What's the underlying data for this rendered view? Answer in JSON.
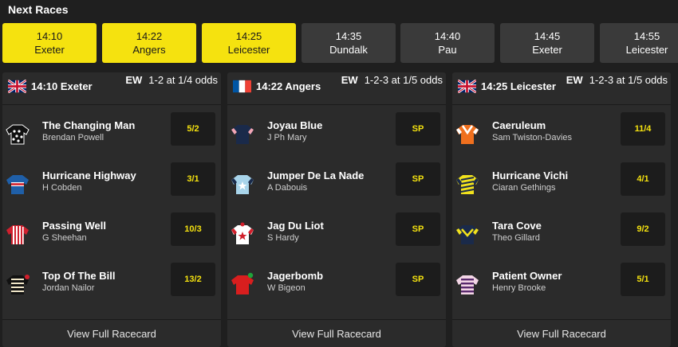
{
  "section_title": "Next Races",
  "tabs": [
    {
      "time": "14:10",
      "course": "Exeter",
      "active": true
    },
    {
      "time": "14:22",
      "course": "Angers",
      "active": true
    },
    {
      "time": "14:25",
      "course": "Leicester",
      "active": true
    },
    {
      "time": "14:35",
      "course": "Dundalk",
      "active": false
    },
    {
      "time": "14:40",
      "course": "Pau",
      "active": false
    },
    {
      "time": "14:45",
      "course": "Exeter",
      "active": false
    },
    {
      "time": "14:55",
      "course": "Leicester",
      "active": false
    }
  ],
  "cards": [
    {
      "flag": "uk-flag-icon",
      "race": "14:10 Exeter",
      "ew_label": "EW",
      "ew_terms": "1-2 at 1/4 odds",
      "racecard_link": "View Full Racecard",
      "runners": [
        {
          "name": "The Changing Man",
          "jockey": "Brendan Powell",
          "odds": "5/2",
          "silk": "black-white-silk-icon"
        },
        {
          "name": "Hurricane Highway",
          "jockey": "H Cobden",
          "odds": "3/1",
          "silk": "blue-red-silk-icon"
        },
        {
          "name": "Passing Well",
          "jockey": "G Sheehan",
          "odds": "10/3",
          "silk": "red-white-stripes-silk-icon"
        },
        {
          "name": "Top Of The Bill",
          "jockey": "Jordan Nailor",
          "odds": "13/2",
          "silk": "black-cream-hoops-silk-icon"
        }
      ]
    },
    {
      "flag": "france-flag-icon",
      "race": "14:22 Angers",
      "ew_label": "EW",
      "ew_terms": "1-2-3 at 1/5 odds",
      "racecard_link": "View Full Racecard",
      "runners": [
        {
          "name": "Joyau Blue",
          "jockey": "J Ph Mary",
          "odds": "SP",
          "silk": "navy-pink-silk-icon"
        },
        {
          "name": "Jumper De La Nade",
          "jockey": "A Dabouis",
          "odds": "SP",
          "silk": "lightblue-star-silk-icon"
        },
        {
          "name": "Jag Du Liot",
          "jockey": "S Hardy",
          "odds": "SP",
          "silk": "white-red-star-silk-icon"
        },
        {
          "name": "Jagerbomb",
          "jockey": "W Bigeon",
          "odds": "SP",
          "silk": "red-green-silk-icon"
        }
      ]
    },
    {
      "flag": "uk-flag-icon",
      "race": "14:25 Leicester",
      "ew_label": "EW",
      "ew_terms": "1-2-3 at 1/5 odds",
      "racecard_link": "View Full Racecard",
      "runners": [
        {
          "name": "Caeruleum",
          "jockey": "Sam Twiston-Davies",
          "odds": "11/4",
          "silk": "orange-white-silk-icon"
        },
        {
          "name": "Hurricane Vichi",
          "jockey": "Ciaran Gethings",
          "odds": "4/1",
          "silk": "yellow-navy-silk-icon"
        },
        {
          "name": "Tara Cove",
          "jockey": "Theo Gillard",
          "odds": "9/2",
          "silk": "navy-yellow-silk-icon"
        },
        {
          "name": "Patient Owner",
          "jockey": "Henry Brooke",
          "odds": "5/1",
          "silk": "purple-pink-silk-icon"
        }
      ]
    }
  ],
  "colors": {
    "accent": "#f5e20f",
    "tab_inactive": "#3a3a3a",
    "card_bg": "#2b2b2b",
    "page_bg": "#1f1f1f"
  }
}
